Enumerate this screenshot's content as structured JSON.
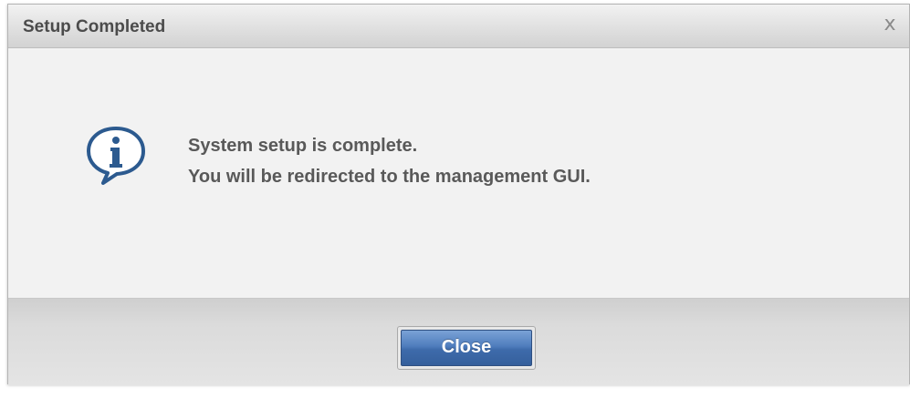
{
  "dialog": {
    "title": "Setup Completed",
    "close_glyph": "x",
    "icon": "info-speech-bubble-icon",
    "messages": [
      "System setup is complete.",
      "You will be redirected to the management GUI."
    ],
    "close_button_label": "Close"
  },
  "colors": {
    "title_text": "#4b4b4b",
    "message_text": "#595959",
    "button_blue": "#4f7dbd",
    "icon_blue": "#2c5a8f"
  }
}
